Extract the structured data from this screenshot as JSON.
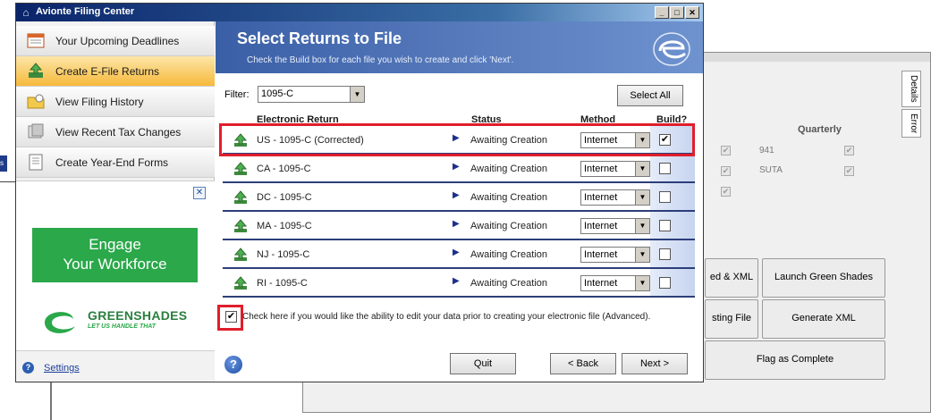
{
  "window": {
    "title": "Avionte Filing Center"
  },
  "sidebar": {
    "items": [
      {
        "label": "Your Upcoming Deadlines",
        "icon": "calendar-icon"
      },
      {
        "label": "Create E-File Returns",
        "icon": "upload-icon"
      },
      {
        "label": "View Filing History",
        "icon": "folder-icon"
      },
      {
        "label": "View Recent Tax Changes",
        "icon": "tax-changes-icon"
      },
      {
        "label": "Create Year-End Forms",
        "icon": "document-icon"
      }
    ],
    "active_index": 1,
    "ad": {
      "line1": "Engage",
      "line2": "Your Workforce",
      "brand": "GREENSHADES",
      "tagline": "LET US HANDLE THAT"
    },
    "settings_label": "Settings"
  },
  "main": {
    "title": "Select Returns to File",
    "subtitle": "Check the Build box for each file you wish to create and click 'Next'.",
    "filter_label": "Filter:",
    "filter_value": "1095-C",
    "select_all_label": "Select All",
    "columns": {
      "return": "Electronic Return",
      "status": "Status",
      "method": "Method",
      "build": "Build?"
    },
    "rows": [
      {
        "name": "US - 1095-C (Corrected)",
        "status": "Awaiting Creation",
        "method": "Internet",
        "build": "✔"
      },
      {
        "name": "CA - 1095-C",
        "status": "Awaiting Creation",
        "method": "Internet",
        "build": ""
      },
      {
        "name": "DC - 1095-C",
        "status": "Awaiting Creation",
        "method": "Internet",
        "build": ""
      },
      {
        "name": "MA - 1095-C",
        "status": "Awaiting Creation",
        "method": "Internet",
        "build": ""
      },
      {
        "name": "NJ - 1095-C",
        "status": "Awaiting Creation",
        "method": "Internet",
        "build": ""
      },
      {
        "name": "RI - 1095-C",
        "status": "Awaiting Creation",
        "method": "Internet",
        "build": ""
      }
    ],
    "advanced_checked": "✔",
    "advanced_label": "Check here if you would like the ability to edit your data prior to creating your electronic file (Advanced).",
    "buttons": {
      "quit": "Quit",
      "back": "< Back",
      "next": "Next >"
    }
  },
  "background": {
    "tabs": [
      "Details",
      "Error"
    ],
    "quarterly_header": "Quarterly",
    "quarterly_items": [
      "941",
      "SUTA"
    ],
    "buttons": [
      "ed & XML",
      "Launch Green Shades",
      "sting File",
      "Generate XML",
      "Flag as Complete"
    ]
  },
  "colors": {
    "highlight": "#e01e2b",
    "header": "#3b5fa6",
    "active_nav": "#f6b93b",
    "ad_green": "#2aa84a"
  }
}
